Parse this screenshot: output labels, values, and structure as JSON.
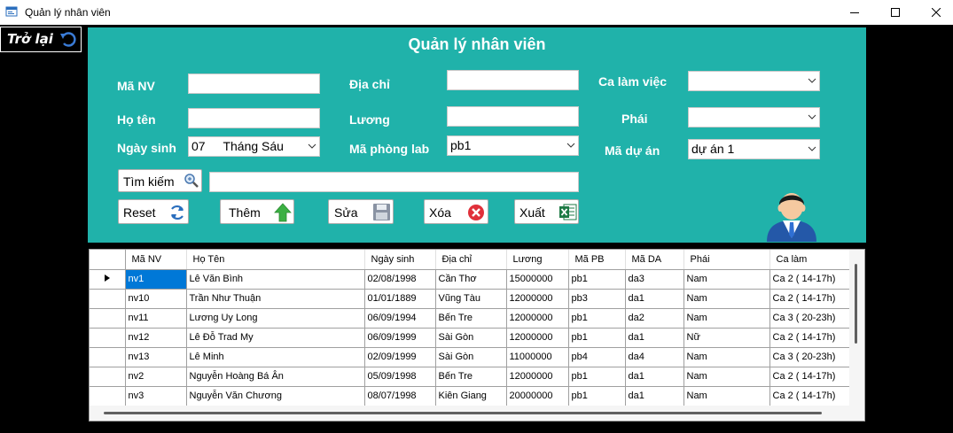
{
  "window": {
    "title": "Quản lý nhân viên",
    "minimize_icon": "minimize-icon",
    "maximize_icon": "maximize-icon",
    "close_icon": "close-icon"
  },
  "back_button": {
    "label": "Trở lại",
    "icon": "undo-icon"
  },
  "form": {
    "title": "Quản lý nhân viên",
    "labels": {
      "ma_nv": "Mã NV",
      "ho_ten": "Họ tên",
      "ngay_sinh": "Ngày sinh",
      "dia_chi": "Địa chỉ",
      "luong": "Lương",
      "ma_phong_lab": "Mã phòng lab",
      "ca_lam_viec": "Ca làm việc",
      "phai": "Phái",
      "ma_du_an": "Mã dự án"
    },
    "values": {
      "ma_nv": "",
      "ho_ten": "",
      "ngay_sinh_day": "07",
      "ngay_sinh_month": "Tháng Sáu",
      "dia_chi": "",
      "luong": "",
      "ma_phong_lab": "pb1",
      "ca_lam_viec": "",
      "phai": "",
      "ma_du_an": "dự án 1",
      "search": ""
    }
  },
  "buttons": {
    "search": "Tìm kiếm",
    "reset": "Reset",
    "add": "Thêm",
    "edit": "Sửa",
    "delete": "Xóa",
    "export": "Xuất"
  },
  "table": {
    "columns": [
      "Mã NV",
      "Họ Tên",
      "Ngày sinh",
      "Địa chỉ",
      "Lương",
      "Mã PB",
      "Mã DA",
      "Phái",
      "Ca làm"
    ],
    "rows": [
      [
        "nv1",
        "Lê Văn Bình",
        "02/08/1998",
        "Cần Thơ",
        "15000000",
        "pb1",
        "da3",
        "Nam",
        "Ca 2 ( 14-17h)"
      ],
      [
        "nv10",
        "Trần Như Thuận",
        "01/01/1889",
        "Vũng Tàu",
        "12000000",
        "pb3",
        "da1",
        "Nam",
        "Ca 2 ( 14-17h)"
      ],
      [
        "nv11",
        "Lương Uy Long",
        "06/09/1994",
        "Bến Tre",
        "12000000",
        "pb1",
        "da2",
        "Nam",
        "Ca 3 ( 20-23h)"
      ],
      [
        "nv12",
        "Lê Đỗ Trad My",
        "06/09/1999",
        "Sài Gòn",
        "12000000",
        "pb1",
        "da1",
        "Nữ",
        "Ca 2 ( 14-17h)"
      ],
      [
        "nv13",
        "Lê Minh",
        "02/09/1999",
        "Sài Gòn",
        "11000000",
        "pb4",
        "da4",
        "Nam",
        "Ca 3 ( 20-23h)"
      ],
      [
        "nv2",
        "Nguyễn Hoàng Bá Ân",
        "05/09/1998",
        "Bến Tre",
        "12000000",
        "pb1",
        "da1",
        "Nam",
        "Ca 2 ( 14-17h)"
      ],
      [
        "nv3",
        "Nguyễn Văn Chương",
        "08/07/1998",
        "Kiên Giang",
        "20000000",
        "pb1",
        "da1",
        "Nam",
        "Ca 2 ( 14-17h)"
      ]
    ],
    "selected_row": 0,
    "current_row_marker": "row-pointer-icon"
  },
  "colors": {
    "panel": "#20b2aa",
    "selection": "#0078d7",
    "background": "#000000"
  }
}
